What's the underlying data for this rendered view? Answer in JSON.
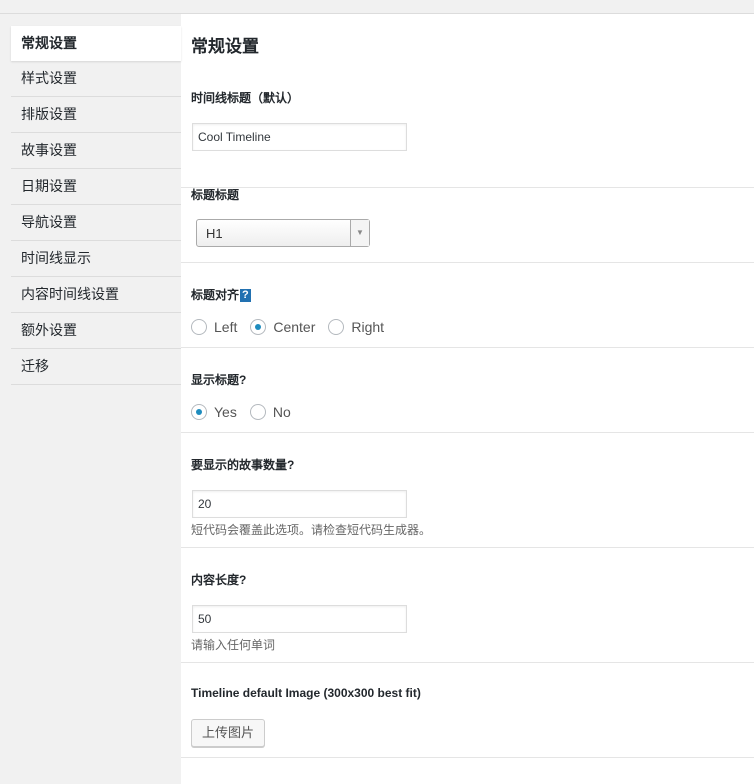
{
  "sidebar": {
    "items": [
      {
        "label": "常规设置"
      },
      {
        "label": "样式设置"
      },
      {
        "label": "排版设置"
      },
      {
        "label": "故事设置"
      },
      {
        "label": "日期设置"
      },
      {
        "label": "导航设置"
      },
      {
        "label": "时间线显示"
      },
      {
        "label": "内容时间线设置"
      },
      {
        "label": "额外设置"
      },
      {
        "label": "迁移"
      }
    ]
  },
  "main": {
    "title": "常规设置",
    "timeline_title": {
      "label": "时间线标题（默认）",
      "value": "Cool Timeline"
    },
    "title_heading": {
      "label": "标题标题",
      "selected": "H1"
    },
    "title_alignment": {
      "label": "标题对齐",
      "help_icon": "?",
      "options": [
        "Left",
        "Center",
        "Right"
      ],
      "selected": "Center"
    },
    "display_title": {
      "label": "显示标题?",
      "options": [
        "Yes",
        "No"
      ],
      "selected": "Yes"
    },
    "story_count": {
      "label": "要显示的故事数量?",
      "value": "20",
      "help": "短代码会覆盖此选项。请检查短代码生成器。"
    },
    "content_length": {
      "label": "内容长度?",
      "value": "50",
      "help": "请输入任何单词"
    },
    "default_image": {
      "label": "Timeline default Image (300x300 best fit)",
      "button": "上传图片"
    }
  },
  "colors": {
    "accent": "#1e8cbe",
    "help_icon_bg": "#2271b1"
  }
}
